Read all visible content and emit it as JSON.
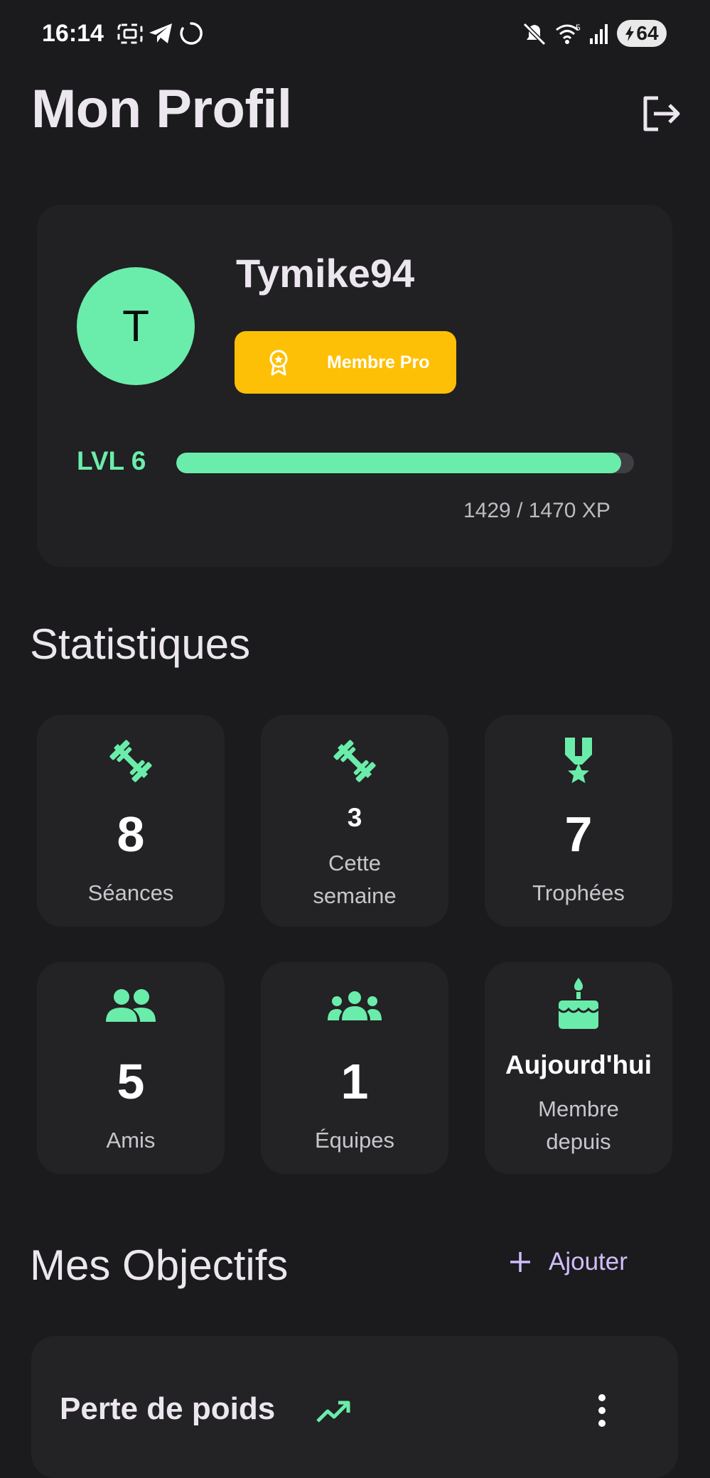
{
  "status_bar": {
    "time": "16:14",
    "battery": "64"
  },
  "header": {
    "title": "Mon Profil"
  },
  "profile": {
    "avatar_initial": "T",
    "username": "Tymike94",
    "badge_label": "Membre Pro",
    "level_label": "LVL 6",
    "xp_text": "1429 / 1470 XP",
    "xp_current": 1429,
    "xp_max": 1470
  },
  "stats": {
    "title": "Statistiques",
    "items": [
      {
        "icon": "dumbbell-icon",
        "value": "8",
        "label": "Séances"
      },
      {
        "icon": "dumbbell-icon",
        "value": "3",
        "label_line1": "Cette",
        "label_line2": "semaine"
      },
      {
        "icon": "medal-icon",
        "value": "7",
        "label": "Trophées"
      },
      {
        "icon": "friends-icon",
        "value": "5",
        "label": "Amis"
      },
      {
        "icon": "groups-icon",
        "value": "1",
        "label": "Équipes"
      },
      {
        "icon": "cake-icon",
        "value": "Aujourd'hui",
        "label_line1": "Membre",
        "label_line2": "depuis"
      }
    ]
  },
  "objectives": {
    "title": "Mes Objectifs",
    "add_label": "Ajouter",
    "items": [
      {
        "title": "Perte de poids",
        "icon": "trending-up-icon"
      }
    ]
  },
  "colors": {
    "background": "#1b1b1d",
    "card": "#232225",
    "accent_green": "#6aedaa",
    "badge_gold": "#fec006",
    "accent_purple": "#d1bdfb"
  }
}
